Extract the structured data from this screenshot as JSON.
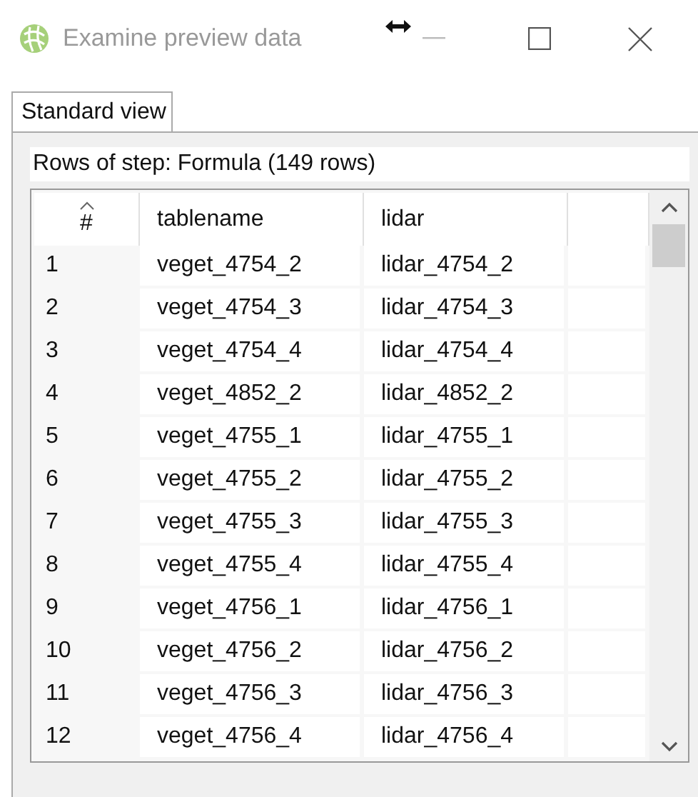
{
  "window": {
    "title": "Examine preview data"
  },
  "tabs": [
    {
      "label": "Standard view",
      "selected": true
    }
  ],
  "caption": "Rows of step: Formula (149 rows)",
  "table": {
    "columns": [
      "#",
      "tablename",
      "lidar"
    ],
    "rows": [
      [
        "1",
        "veget_4754_2",
        "lidar_4754_2"
      ],
      [
        "2",
        "veget_4754_3",
        "lidar_4754_3"
      ],
      [
        "3",
        "veget_4754_4",
        "lidar_4754_4"
      ],
      [
        "4",
        "veget_4852_2",
        "lidar_4852_2"
      ],
      [
        "5",
        "veget_4755_1",
        "lidar_4755_1"
      ],
      [
        "6",
        "veget_4755_2",
        "lidar_4755_2"
      ],
      [
        "7",
        "veget_4755_3",
        "lidar_4755_3"
      ],
      [
        "8",
        "veget_4755_4",
        "lidar_4755_4"
      ],
      [
        "9",
        "veget_4756_1",
        "lidar_4756_1"
      ],
      [
        "10",
        "veget_4756_2",
        "lidar_4756_2"
      ],
      [
        "11",
        "veget_4756_3",
        "lidar_4756_3"
      ],
      [
        "12",
        "veget_4756_4",
        "lidar_4756_4"
      ]
    ]
  }
}
